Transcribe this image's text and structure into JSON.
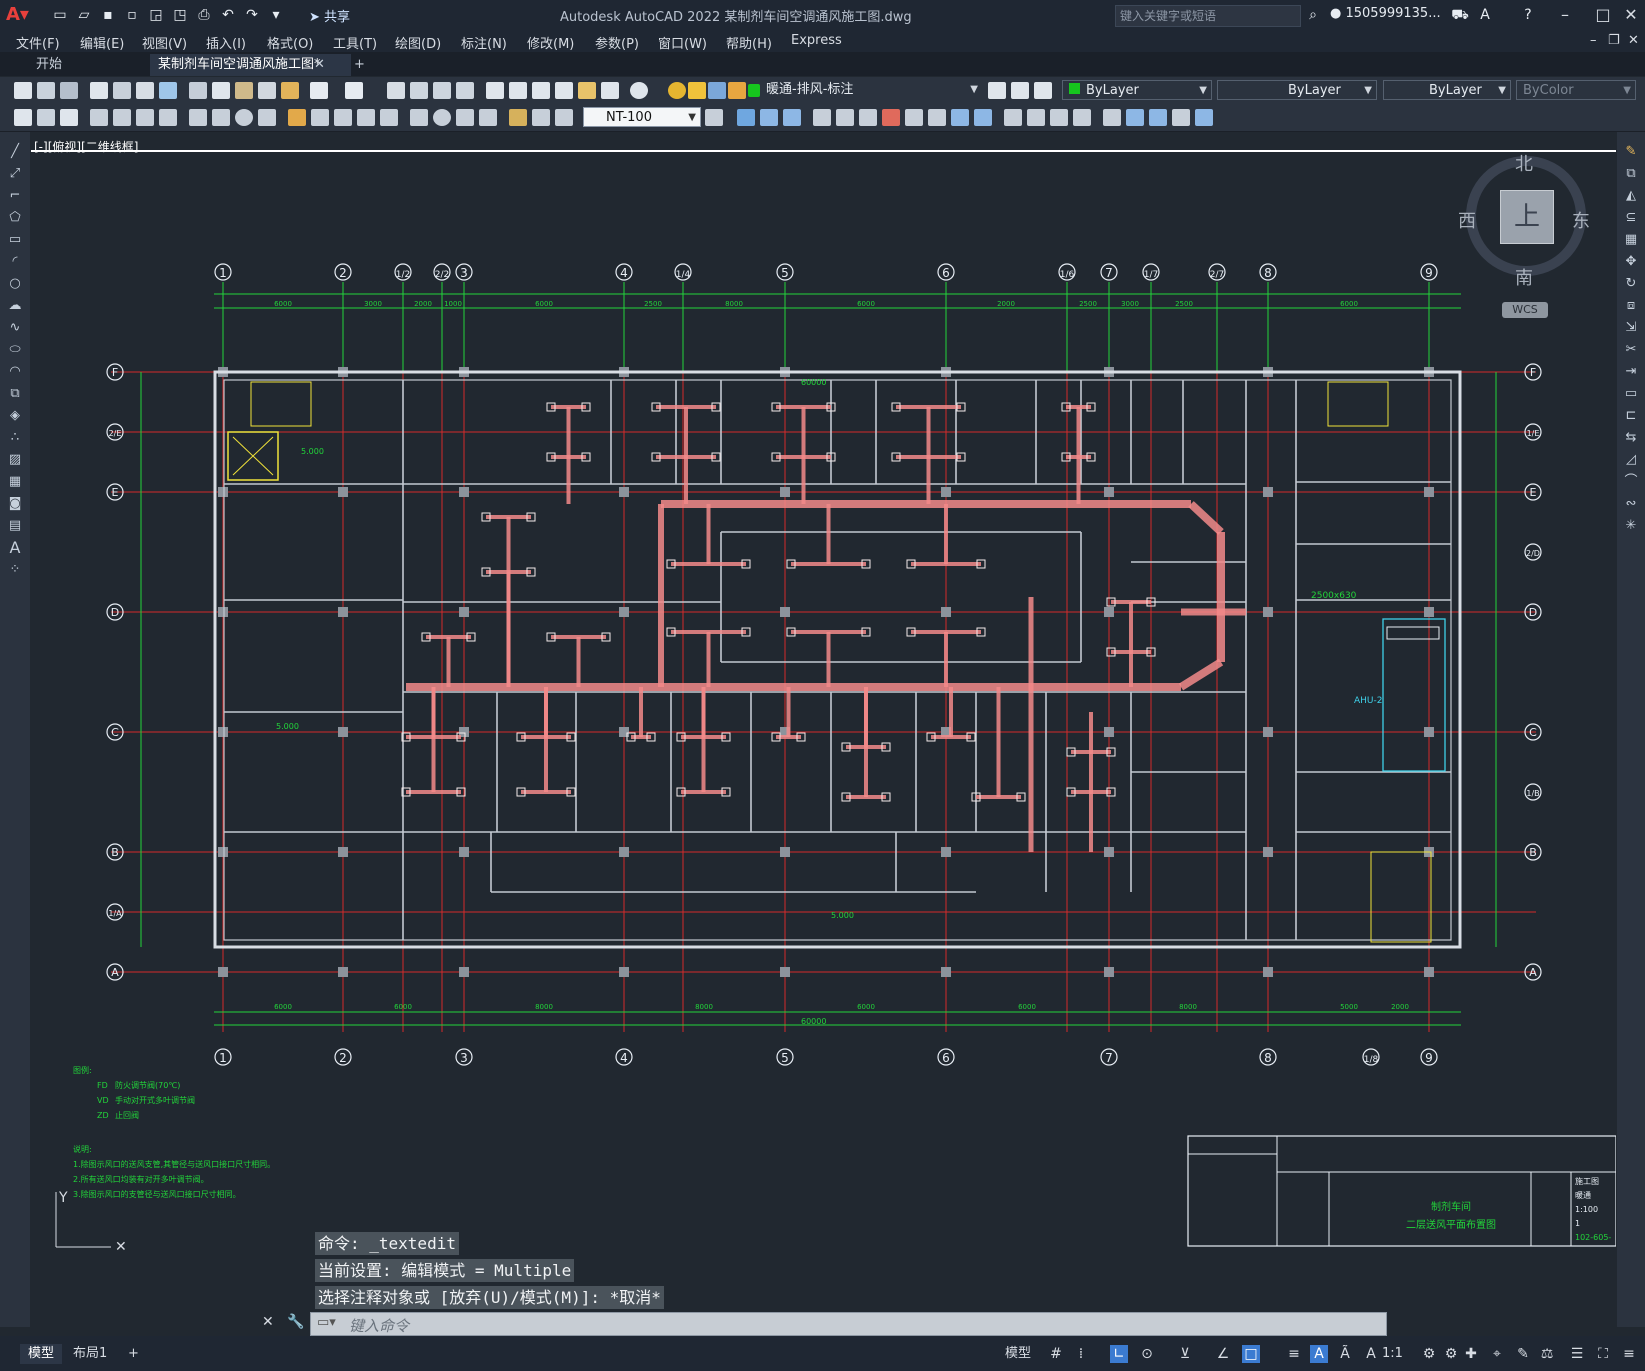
{
  "app": {
    "title": "Autodesk AutoCAD 2022    某制剂车间空调通风施工图.dwg",
    "share_label": "共享",
    "search_placeholder": "键入关键字或短语",
    "user": "1505999135..."
  },
  "menu": [
    "文件(F)",
    "编辑(E)",
    "视图(V)",
    "插入(I)",
    "格式(O)",
    "工具(T)",
    "绘图(D)",
    "标注(N)",
    "修改(M)",
    "参数(P)",
    "窗口(W)",
    "帮助(H)",
    "Express"
  ],
  "tabs": {
    "start": "开始",
    "drawing": "某制剂车间空调通风施工图*",
    "add": "+"
  },
  "toolbar": {
    "layer": "暖通-排风-标注",
    "color": "ByLayer",
    "linetype": "ByLayer",
    "lineweight": "ByLayer",
    "plotstyle": "ByColor",
    "textstyle": "NT-100"
  },
  "viewport_label": "[-][俯视][二维线框]",
  "viewcube": {
    "top": "上",
    "north": "北",
    "south": "南",
    "east": "东",
    "west": "西",
    "wcs": "WCS"
  },
  "drawing": {
    "grid_cols": [
      "1",
      "2",
      "1/2",
      "2/2",
      "3",
      "4",
      "1/4",
      "5",
      "6",
      "1/6",
      "7",
      "1/7",
      "2/7",
      "8",
      "9"
    ],
    "grid_cols_bottom": [
      "1",
      "2",
      "3",
      "4",
      "5",
      "6",
      "7",
      "8",
      "1/8",
      "9"
    ],
    "grid_rows": [
      "F",
      "2/E",
      "E",
      "D",
      "C",
      "B",
      "1/A",
      "A"
    ],
    "grid_rows_right": [
      "F",
      "1/E",
      "E",
      "2/D",
      "D",
      "C",
      "1/B",
      "B",
      "A"
    ],
    "top_dims": [
      "6000",
      "3000",
      "2000",
      "1000",
      "6000",
      "2500",
      "8000",
      "6000",
      "2000",
      "2500",
      "3000",
      "2500",
      "6000"
    ],
    "bottom_dims": [
      "6000",
      "6000",
      "8000",
      "8000",
      "6000",
      "6000",
      "8000",
      "5000",
      "2000"
    ],
    "overall": "60000",
    "elevation": "5.000",
    "ahu": "AHU-2",
    "ahu_duct": "2500x630",
    "legend_title": "图例:",
    "legend": [
      {
        "code": "FD",
        "text": "防火调节阀(70℃)"
      },
      {
        "code": "VD",
        "text": "手动对开式多叶调节阀"
      },
      {
        "code": "ZD",
        "text": "止回阀"
      }
    ],
    "notes_title": "说明:",
    "notes": [
      "1.除图示风口的送风支管,其管径与送风口接口尺寸相同。",
      "2.所有送风口均装有对开多叶调节阀。",
      "3.除图示风口的支管径与送风口接口尺寸相同。"
    ],
    "titleblock": {
      "project": "制剂车间",
      "sheet": "二层送风平面布置图",
      "stage": "施工图",
      "discipline": "暖通",
      "scale": "1:100",
      "rev": "1",
      "dwgno": "102-605-"
    }
  },
  "command": {
    "history": [
      "命令: _textedit",
      "当前设置: 编辑模式 = Multiple",
      "选择注释对象或 [放弃(U)/模式(M)]: *取消*"
    ],
    "placeholder": "键入命令"
  },
  "status": {
    "tab_model": "模型",
    "tab_layout": "布局1",
    "add": "+",
    "mode": "模型",
    "scale": "1:1"
  },
  "colors": {
    "accent_red": "#e8403c",
    "grid_green": "#22d33a",
    "duct_pink": "#f28a8a",
    "axis_red": "#d42a2a"
  }
}
